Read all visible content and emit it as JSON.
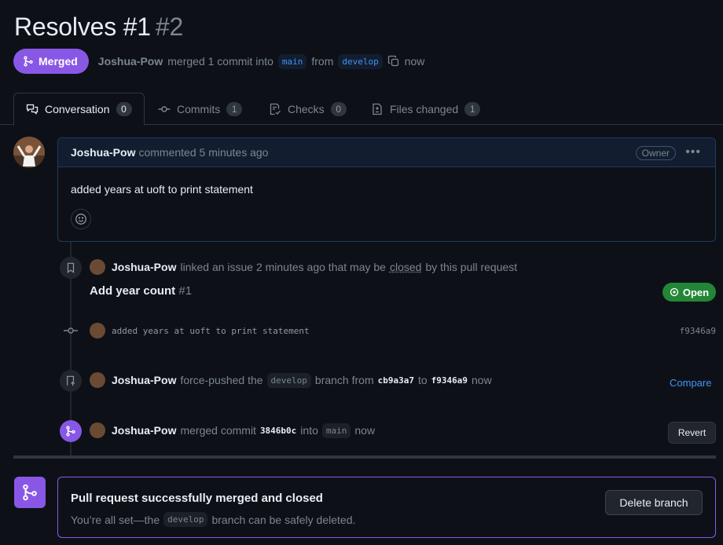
{
  "colors": {
    "merged": "#8957e5",
    "open": "#238636",
    "link": "#4493f8",
    "background": "#0d1117"
  },
  "pr": {
    "title": "Resolves #1",
    "number": "#2",
    "status": "Merged",
    "author": "Joshua-Pow",
    "merge_text": "merged 1 commit into",
    "base_branch": "main",
    "from_text": "from",
    "head_branch": "develop",
    "time": "now"
  },
  "tabs": [
    {
      "label": "Conversation",
      "count": "0",
      "icon": "comment-discussion-icon"
    },
    {
      "label": "Commits",
      "count": "1",
      "icon": "git-commit-icon"
    },
    {
      "label": "Checks",
      "count": "0",
      "icon": "checklist-icon"
    },
    {
      "label": "Files changed",
      "count": "1",
      "icon": "file-diff-icon"
    }
  ],
  "comment": {
    "author": "Joshua-Pow",
    "action": "commented",
    "time": "5 minutes ago",
    "role": "Owner",
    "body": "added years at uoft to print statement"
  },
  "timeline": {
    "linked": {
      "author": "Joshua-Pow",
      "text_before": "linked an issue 2 minutes ago that may be",
      "closed_word": "closed",
      "text_after": "by this pull request",
      "issue_title": "Add year count",
      "issue_number": "#1",
      "issue_status": "Open"
    },
    "commit": {
      "message": "added years at uoft to print statement",
      "sha": "f9346a9"
    },
    "force_push": {
      "author": "Joshua-Pow",
      "text1": "force-pushed the",
      "branch": "develop",
      "text2": "branch from",
      "from_sha": "cb9a3a7",
      "text3": "to",
      "to_sha": "f9346a9",
      "time": "now",
      "compare_label": "Compare"
    },
    "merged": {
      "author": "Joshua-Pow",
      "text1": "merged commit",
      "sha": "3846b0c",
      "text2": "into",
      "branch": "main",
      "time": "now",
      "revert_label": "Revert"
    }
  },
  "merge_box": {
    "heading": "Pull request successfully merged and closed",
    "sub_before": "You’re all set—the",
    "branch": "develop",
    "sub_after": "branch can be safely deleted.",
    "delete_label": "Delete branch"
  }
}
